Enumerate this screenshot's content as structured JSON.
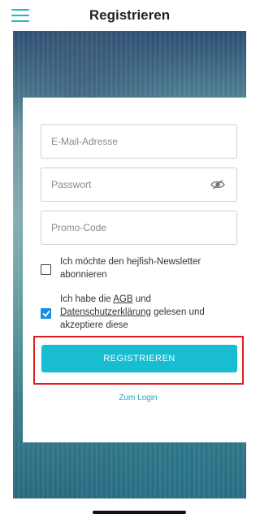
{
  "header": {
    "title": "Registrieren"
  },
  "form": {
    "email_placeholder": "E-Mail-Adresse",
    "password_placeholder": "Passwort",
    "promo_placeholder": "Promo-Code",
    "newsletter_label": "Ich möchte den hejfish-Newsletter abonnieren",
    "newsletter_checked": false,
    "terms_prefix": "Ich habe die ",
    "terms_agb": "AGB",
    "terms_and": " und ",
    "terms_privacy": "Datenschutzerklärung",
    "terms_suffix": " gelesen und akzeptiere diese",
    "terms_checked": true,
    "register_label": "REGISTRIEREN",
    "login_link": "Zum Login"
  },
  "colors": {
    "accent": "#19bdd1",
    "checkbox_checked": "#1a8fe0",
    "highlight_border": "#e11e1e"
  },
  "icons": {
    "menu": "hamburger-menu-icon",
    "password_toggle": "eye-slash-icon",
    "checkmark": "checkmark-icon"
  }
}
